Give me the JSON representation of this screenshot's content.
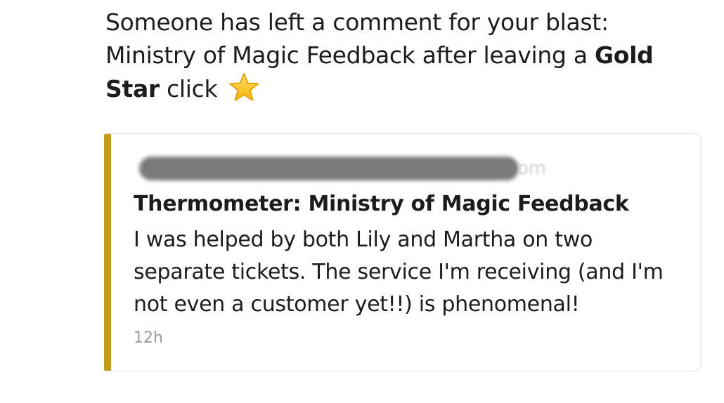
{
  "message": {
    "line1": "Someone has left a comment for your blast:",
    "line2_text": "Ministry of Magic Feedback after leaving a ",
    "gold_star_bold": "Gold Star",
    "click_text": " click",
    "emoji": "star-emoji"
  },
  "attachment": {
    "accent_color": "#c9980f",
    "sender_email_tail": "om",
    "title": "Thermometer: Ministry of Magic Feedback",
    "body": "I was helped by both Lily and Martha on two separate tickets.  The service I'm receiving (and I'm not even a customer yet!!) is phenomenal!",
    "timestamp": "12h"
  }
}
